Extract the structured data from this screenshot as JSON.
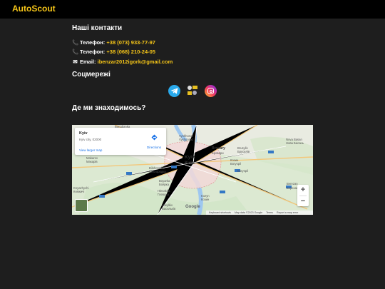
{
  "header": {
    "brand": "AutoScout"
  },
  "contacts": {
    "title": "Наші контакти",
    "phone1_label": "Телефон:",
    "phone1": "+38 (073) 933-77-97",
    "phone2_label": "Телефон:",
    "phone2": "+38 (068) 210-24-05",
    "email_label": "Email:",
    "email": "ibenzar2012igork@gmail.com",
    "phone_icon": "phone-icon",
    "email_icon": "envelope-icon"
  },
  "social": {
    "title": "Соцмережі",
    "items": [
      "telegram-icon",
      "avatar-icon",
      "instagram-icon"
    ]
  },
  "location": {
    "title": "Де ми знаходимось?"
  },
  "map": {
    "card_title": "Kyiv",
    "card_subtitle": "Kyiv city, 02000",
    "card_link": "View larger map",
    "directions": "Directions",
    "zoom_in": "+",
    "zoom_out": "−",
    "city_label": "Kyiv",
    "city_label_local": "Київ",
    "place_labels": [
      "Borodianka",
      "Vyshhorod",
      "Vyshgorod",
      "Brovary",
      "Бровари",
      "Hostomel",
      "Irpin",
      "Ірпінь",
      "Makarov",
      "Макарів",
      "Bilohorodka",
      "Білогородка",
      "Boyarka",
      "Боярка",
      "Hlevakha",
      "Глеваха",
      "Vasylkiv",
      "Васильків",
      "Kozyn",
      "Козин",
      "Boryspil",
      "Бориспіль",
      "Velyka Dymerka",
      "Nova Basan",
      "Нова Басань",
      "Berezan",
      "Березань",
      "Brusyliv",
      "Брусилів",
      "Knyazhychi",
      "Княжичі"
    ],
    "google": "Google",
    "attribution": [
      "Keyboard shortcuts",
      "Map data ©2023 Google",
      "Terms",
      "Report a map error"
    ]
  },
  "colors": {
    "accent": "#f5c518",
    "background": "#1e1e1e",
    "topbar": "#000000"
  }
}
